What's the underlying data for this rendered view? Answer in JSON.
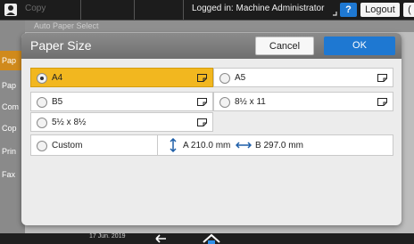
{
  "topbar": {
    "app_label": "Copy",
    "login_text": "Logged in: Machine Administrator",
    "help_label": "?",
    "logout_label": "Logout",
    "extra_label": "(",
    "hidden_text": "Auto Paper Select"
  },
  "background": {
    "left_tabs": [
      "Pap",
      "Pap",
      "Com",
      "Cop",
      "Prin",
      "Fax"
    ]
  },
  "dialog": {
    "title": "Paper Size",
    "cancel_label": "Cancel",
    "ok_label": "OK",
    "options": [
      {
        "label": "A4",
        "selected": true,
        "icon": "landscape-orientation-icon"
      },
      {
        "label": "A5",
        "selected": false,
        "icon": "landscape-orientation-icon"
      },
      {
        "label": "B5",
        "selected": false,
        "icon": "landscape-orientation-icon"
      },
      {
        "label": "8½ x 11",
        "selected": false,
        "icon": "landscape-orientation-icon"
      },
      {
        "label": "5½ x 8½",
        "selected": false,
        "icon": "landscape-orientation-icon"
      }
    ],
    "custom": {
      "label": "Custom",
      "dimension_a": "A 210.0 mm",
      "dimension_b": "B 297.0 mm"
    }
  },
  "bottombar": {
    "date": "17 Jun. 2019"
  },
  "colors": {
    "selected": "#f2b71f",
    "ok_button": "#1e78d2",
    "header": "#7d7d7d"
  }
}
